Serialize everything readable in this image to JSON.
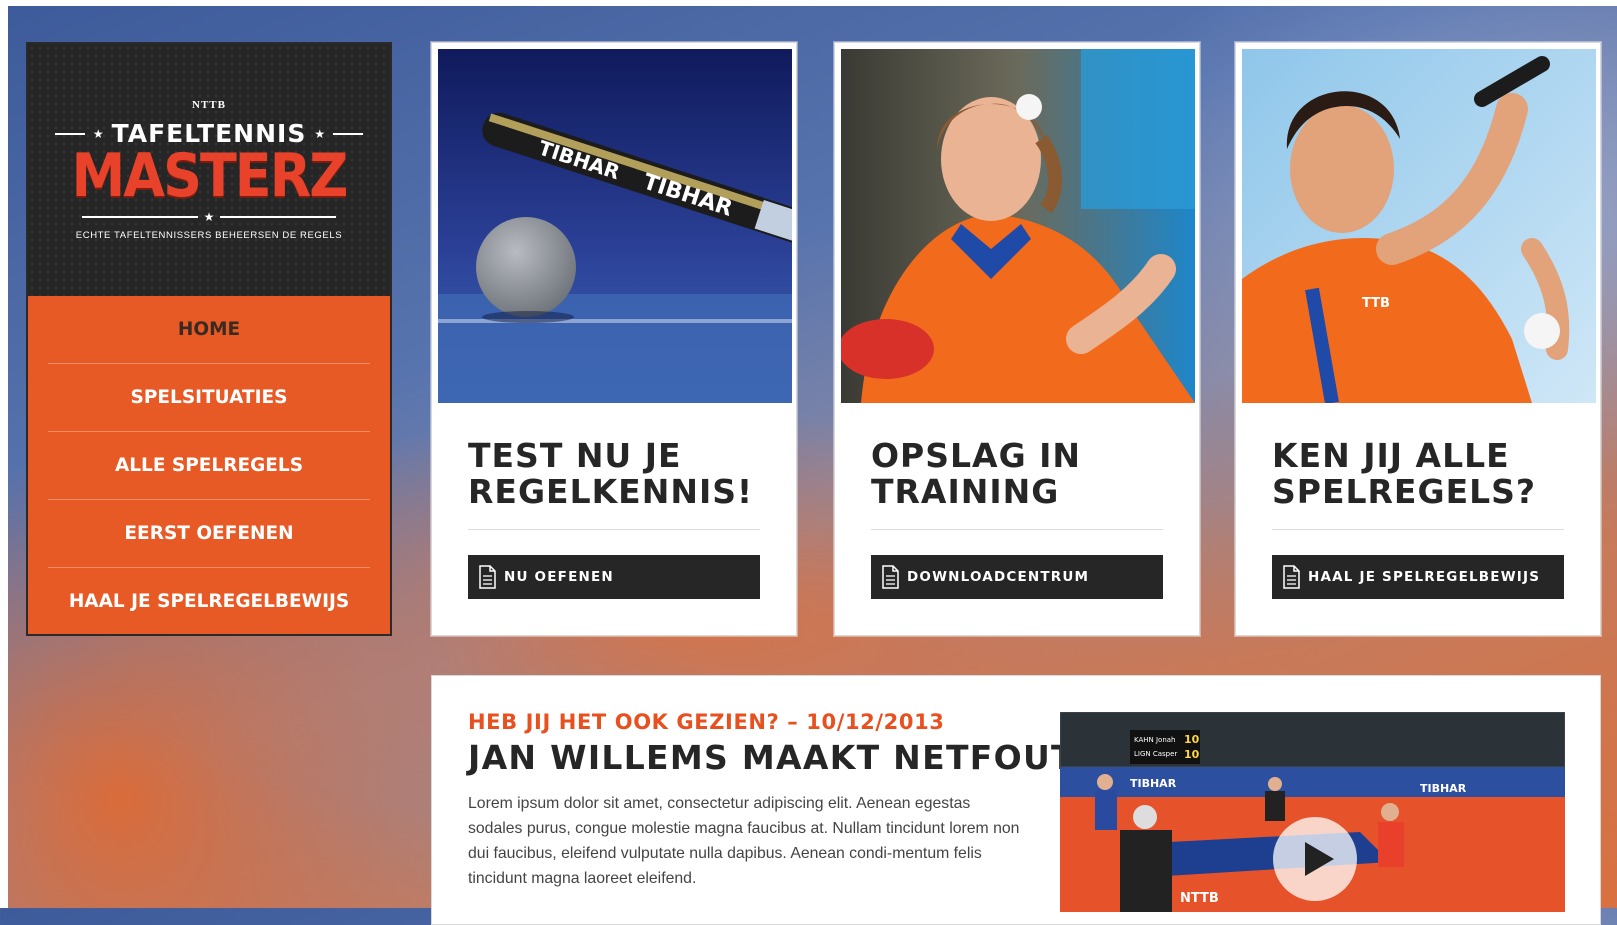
{
  "logo": {
    "nttb": "NTTB",
    "tafeltennis": "TAFELTENNIS",
    "masterz": "MASTERZ",
    "tagline": "ECHTE TAFELTENNISSERS BEHEERSEN DE REGELS"
  },
  "nav": {
    "items": [
      {
        "label": "HOME",
        "active": true
      },
      {
        "label": "SPELSITUATIES"
      },
      {
        "label": "ALLE SPELREGELS"
      },
      {
        "label": "EERST OEFENEN"
      },
      {
        "label": "HAAL JE SPELREGELBEWIJS"
      }
    ]
  },
  "cards": [
    {
      "title_line1": "TEST NU JE",
      "title_line2": "REGELKENNIS!",
      "button": "NU OEFENEN"
    },
    {
      "title_line1": "OPSLAG IN",
      "title_line2": "TRAINING",
      "button": "DOWNLOADCENTRUM"
    },
    {
      "title_line1": "KEN JIJ ALLE",
      "title_line2": "SPELREGELS?",
      "button": "HAAL JE SPELREGELBEWIJS"
    }
  ],
  "news": {
    "kicker": "HEB JIJ HET OOK GEZIEN? – 10/12/2013",
    "title": "JAN WILLEMS MAAKT NETFOUT",
    "body": "Lorem ipsum dolor sit amet, consectetur adipiscing elit. Aenean egestas sodales purus, congue molestie magna faucibus at. Nullam tincidunt lorem non dui faucibus, eleifend vulputate nulla dapibus. Aenean condi-mentum felis tincidunt magna laoreet eleifend.",
    "video": {
      "scoreboard_name1": "KAHN Jonah",
      "scoreboard_name2": "LIGN Casper",
      "score1": "10",
      "score2": "10",
      "banner_text": "TIBHAR",
      "table_text": "NTTB"
    }
  },
  "photos": {
    "racket_brand": "TIBHAR",
    "shirt_logo": "TTB",
    "shirt_text": "NTTB"
  },
  "colors": {
    "accent": "#e85a25",
    "dark": "#262626",
    "kicker": "#e8501f"
  }
}
